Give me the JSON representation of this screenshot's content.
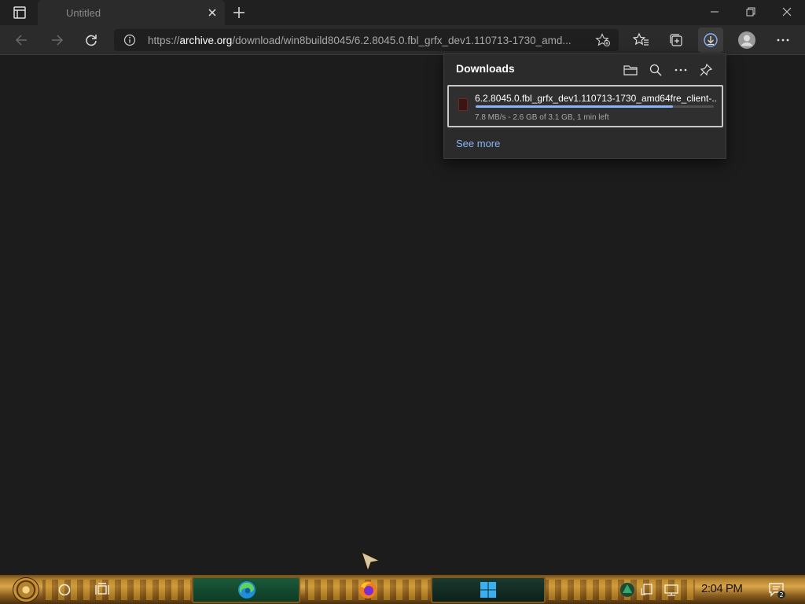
{
  "browser": {
    "tab": {
      "title": "Untitled"
    },
    "address": {
      "prefix": "https://",
      "host": "archive.org",
      "path": "/download/win8build8045/6.2.8045.0.fbl_grfx_dev1.110713-1730_amd..."
    },
    "icons": [
      "tab-actions-icon",
      "close-icon",
      "plus-icon",
      "back-icon",
      "forward-icon",
      "refresh-icon",
      "info-icon",
      "add-favorite-icon",
      "favorites-icon",
      "collections-icon",
      "download-icon",
      "profile-icon",
      "more-icon"
    ]
  },
  "downloads": {
    "title": "Downloads",
    "items": [
      {
        "filename": "6.2.8045.0.fbl_grfx_dev1.110713-1730_amd64fre_client-...",
        "status": "7.8 MB/s - 2.6 GB of 3.1 GB, 1 min left",
        "progress": 0.83
      }
    ],
    "see_more": "See more"
  },
  "taskbar": {
    "clock": "2:04 PM",
    "notification_count": "2"
  },
  "colors": {
    "accent": "#8ab4f8",
    "background": "#1c1c1c",
    "toolbar": "#2b2b2b"
  }
}
